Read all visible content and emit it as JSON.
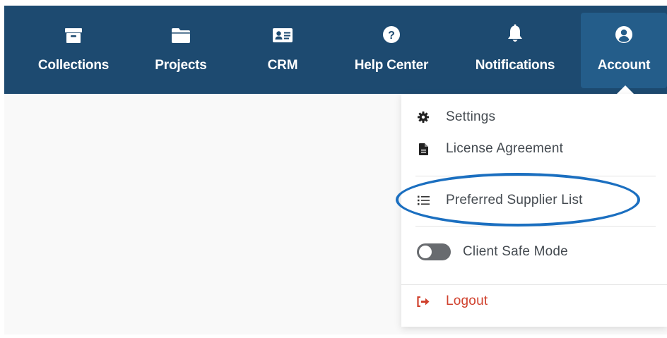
{
  "nav": {
    "items": [
      {
        "label": "Collections",
        "icon": "archive-box-icon"
      },
      {
        "label": "Projects",
        "icon": "folder-icon"
      },
      {
        "label": "CRM",
        "icon": "contact-card-icon"
      },
      {
        "label": "Help Center",
        "icon": "question-circle-icon"
      },
      {
        "label": "Notifications",
        "icon": "bell-icon"
      },
      {
        "label": "Account",
        "icon": "user-circle-icon",
        "active": true
      }
    ]
  },
  "account_menu": {
    "settings": "Settings",
    "license": "License Agreement",
    "supplier_list": "Preferred Supplier List",
    "client_safe_mode": "Client Safe Mode",
    "client_safe_mode_on": false,
    "logout": "Logout"
  },
  "colors": {
    "nav_bg": "#1d4a70",
    "nav_active_bg": "#245d8a",
    "logout": "#d0412d",
    "highlight": "#1b6fc0"
  }
}
